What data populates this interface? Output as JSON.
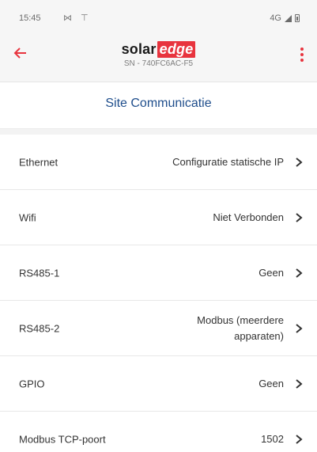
{
  "status_bar": {
    "time": "15:45",
    "left_icons": "⋈ ⊤",
    "network": "4G"
  },
  "header": {
    "logo_solar": "solar",
    "logo_edge": "edge",
    "serial": "SN - 740FC6AC-F5",
    "accent_color": "#e8343e",
    "back_icon": "arrow-left-icon",
    "menu_icon": "kebab-menu-icon"
  },
  "page": {
    "title": "Site Communicatie",
    "title_color": "#1f4e8c"
  },
  "rows": [
    {
      "label": "Ethernet",
      "value": "Configuratie statische IP"
    },
    {
      "label": "Wifi",
      "value": "Niet Verbonden"
    },
    {
      "label": "RS485-1",
      "value": "Geen"
    },
    {
      "label": "RS485-2",
      "value": "Modbus (meerdere apparaten)"
    },
    {
      "label": "GPIO",
      "value": "Geen"
    },
    {
      "label": "Modbus TCP-poort",
      "value": "1502"
    }
  ]
}
